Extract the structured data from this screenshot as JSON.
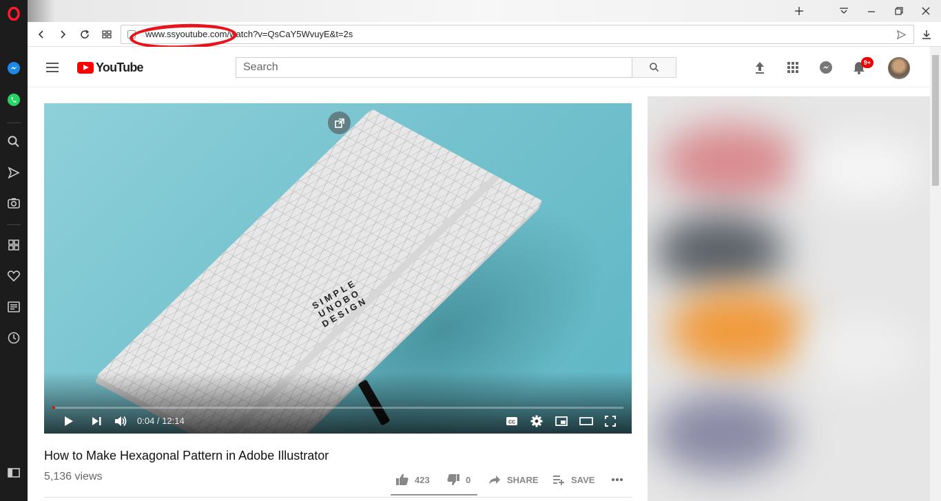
{
  "browser": {
    "logo": "opera-logo",
    "url": "www.ssyoutube.com/watch?v=QsCaY5WvuyE&t=2s",
    "sidebar_icons": [
      "messenger-icon",
      "whatsapp-icon",
      "search-icon",
      "send-icon",
      "camera-icon",
      "speed-dial-icon",
      "heart-icon",
      "news-icon",
      "history-icon",
      "sidebar-toggle-icon"
    ],
    "annotation_color": "#e8141d"
  },
  "youtube": {
    "logo_text": "YouTube",
    "search_placeholder": "Search",
    "notification_badge": "9+",
    "video": {
      "current_time": "0:04",
      "duration": "12:14",
      "time_display": "0:04 / 12:14",
      "progress_fraction": 0.005,
      "cover_text": "SIMPLE UNOBO DESIGN"
    },
    "title": "How to Make Hexagonal Pattern in Adobe Illustrator",
    "views": "5,136 views",
    "actions": {
      "likes": "423",
      "dislikes": "0",
      "share": "SHARE",
      "save": "SAVE"
    }
  },
  "colors": {
    "brand_red": "#ff0000",
    "sidebar_bg": "#1c1c1c",
    "badge_red": "#e00000"
  }
}
